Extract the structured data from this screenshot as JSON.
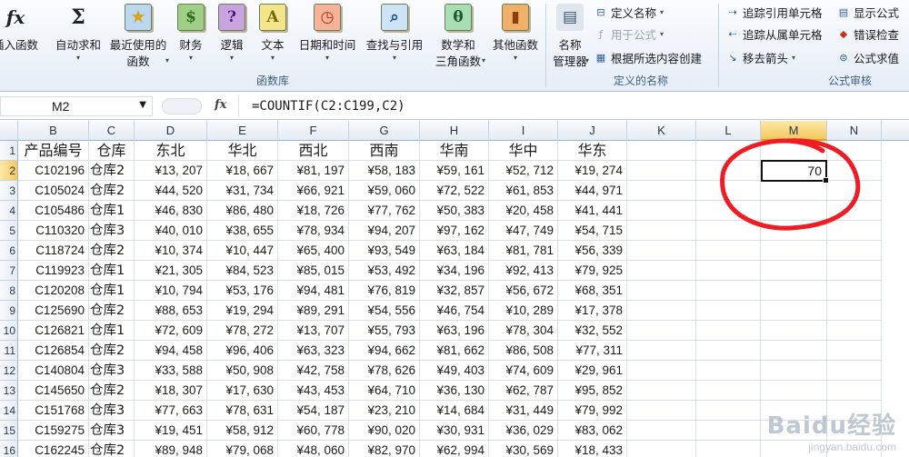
{
  "ribbon": {
    "buttons": [
      {
        "id": "insert-function",
        "label": "插入函数",
        "icon": "fx-icon",
        "glyph": "fx"
      },
      {
        "id": "autosum",
        "label": "自动求和",
        "icon": "sigma-icon",
        "glyph": "Σ"
      },
      {
        "id": "recently-used",
        "label": "最近使用的",
        "label2": "函数",
        "icon": "star-book-icon",
        "glyph": "★"
      },
      {
        "id": "financial",
        "label": "财务",
        "icon": "coins-book-icon",
        "glyph": "$"
      },
      {
        "id": "logical",
        "label": "逻辑",
        "icon": "question-book-icon",
        "glyph": "?"
      },
      {
        "id": "text",
        "label": "文本",
        "icon": "a-book-icon",
        "glyph": "A"
      },
      {
        "id": "date-time",
        "label": "日期和时间",
        "icon": "clock-book-icon",
        "glyph": "◷"
      },
      {
        "id": "lookup-reference",
        "label": "查找与引用",
        "icon": "magnifier-book-icon",
        "glyph": "⌕"
      },
      {
        "id": "math-trig",
        "label": "数学和",
        "label2": "三角函数",
        "icon": "theta-book-icon",
        "glyph": "θ"
      },
      {
        "id": "more-functions",
        "label": "其他函数",
        "icon": "books-icon",
        "glyph": "▮"
      },
      {
        "id": "name-manager",
        "label": "名称",
        "label2": "管理器",
        "icon": "name-manager-icon",
        "glyph": "▤"
      }
    ],
    "library_group": "函数库",
    "defined_names": {
      "define_name": "定义名称",
      "use_in_formula": "用于公式",
      "create_from_selection": "根据所选内容创建",
      "group": "定义的名称"
    },
    "auditing": {
      "trace_precedents": "追踪引用单元格",
      "trace_dependents": "追踪从属单元格",
      "remove_arrows": "移去箭头",
      "show_formulas": "显示公式",
      "error_checking": "错误检查",
      "evaluate_formula": "公式求值",
      "group": "公式审核"
    }
  },
  "formula_bar": {
    "name_box": "M2",
    "fx": "fx",
    "formula": "=COUNTIF(C2:C199,C2)"
  },
  "columns": [
    "B",
    "C",
    "D",
    "E",
    "F",
    "G",
    "H",
    "I",
    "J",
    "K",
    "L",
    "M",
    "N"
  ],
  "selected_column": "M",
  "selected_row": "2",
  "row_numbers": [
    "1",
    "2",
    "3",
    "4",
    "5",
    "6",
    "7",
    "8",
    "9",
    "10",
    "11",
    "12",
    "13",
    "14",
    "15",
    "16"
  ],
  "header_row": [
    "产品编号",
    "仓库",
    "东北",
    "华北",
    "西北",
    "西南",
    "华南",
    "华中",
    "华东"
  ],
  "rows": [
    [
      "C102196",
      "仓库2",
      "¥13, 207",
      "¥18, 667",
      "¥81, 197",
      "¥58, 183",
      "¥59, 161",
      "¥52, 712",
      "¥19, 274"
    ],
    [
      "C105024",
      "仓库2",
      "¥44, 520",
      "¥31, 734",
      "¥66, 921",
      "¥59, 060",
      "¥72, 522",
      "¥61, 853",
      "¥44, 971"
    ],
    [
      "C105486",
      "仓库1",
      "¥46, 830",
      "¥86, 480",
      "¥18, 726",
      "¥77, 762",
      "¥50, 383",
      "¥20, 458",
      "¥41, 441"
    ],
    [
      "C110320",
      "仓库3",
      "¥40, 010",
      "¥38, 655",
      "¥78, 934",
      "¥94, 207",
      "¥97, 162",
      "¥47, 749",
      "¥54, 715"
    ],
    [
      "C118724",
      "仓库2",
      "¥10, 374",
      "¥10, 447",
      "¥65, 400",
      "¥93, 549",
      "¥63, 184",
      "¥81, 781",
      "¥56, 339"
    ],
    [
      "C119923",
      "仓库1",
      "¥21, 305",
      "¥84, 523",
      "¥85, 015",
      "¥53, 492",
      "¥34, 196",
      "¥92, 413",
      "¥79, 925"
    ],
    [
      "C120208",
      "仓库1",
      "¥10, 794",
      "¥53, 176",
      "¥94, 481",
      "¥76, 819",
      "¥32, 857",
      "¥56, 672",
      "¥68, 351"
    ],
    [
      "C125690",
      "仓库2",
      "¥88, 653",
      "¥19, 294",
      "¥89, 291",
      "¥54, 556",
      "¥46, 754",
      "¥10, 289",
      "¥17, 378"
    ],
    [
      "C126821",
      "仓库1",
      "¥72, 609",
      "¥78, 272",
      "¥13, 707",
      "¥55, 793",
      "¥63, 196",
      "¥78, 304",
      "¥32, 552"
    ],
    [
      "C126854",
      "仓库2",
      "¥94, 458",
      "¥96, 406",
      "¥63, 323",
      "¥94, 662",
      "¥81, 662",
      "¥86, 508",
      "¥77, 311"
    ],
    [
      "C140804",
      "仓库3",
      "¥33, 588",
      "¥50, 908",
      "¥42, 758",
      "¥78, 626",
      "¥49, 403",
      "¥74, 609",
      "¥29, 961"
    ],
    [
      "C145650",
      "仓库2",
      "¥18, 307",
      "¥17, 630",
      "¥43, 453",
      "¥64, 710",
      "¥36, 130",
      "¥62, 787",
      "¥95, 852"
    ],
    [
      "C151768",
      "仓库3",
      "¥77, 663",
      "¥78, 631",
      "¥54, 187",
      "¥23, 210",
      "¥14, 684",
      "¥31, 449",
      "¥79, 992"
    ],
    [
      "C159275",
      "仓库3",
      "¥19, 451",
      "¥58, 912",
      "¥60, 778",
      "¥90, 020",
      "¥30, 931",
      "¥36, 029",
      "¥83, 062"
    ],
    [
      "C162245",
      "仓库2",
      "¥89, 948",
      "¥79, 068",
      "¥48, 060",
      "¥82, 970",
      "¥62, 994",
      "¥30, 569",
      "¥18, 433"
    ]
  ],
  "active_cell_value": "70",
  "annotation_color": "#ee1c25",
  "watermark": {
    "brand": "Baidu经验",
    "url": "jingyan.baidu.com"
  }
}
